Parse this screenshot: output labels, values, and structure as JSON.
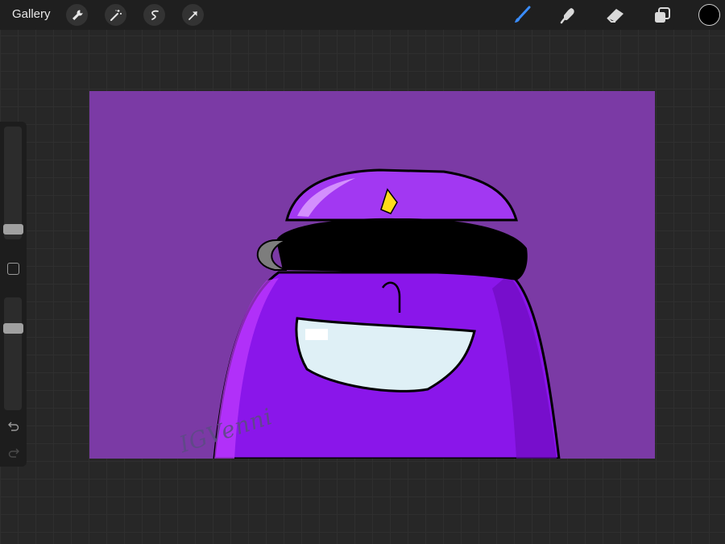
{
  "topbar": {
    "gallery_label": "Gallery",
    "left_tools": [
      "wrench-icon",
      "magic-wand-icon",
      "selection-icon",
      "transform-arrow-icon"
    ],
    "right_tools": [
      "brush-icon",
      "smudge-icon",
      "eraser-icon",
      "layers-icon"
    ],
    "active_tool": "brush",
    "active_tool_color": "#3a8dff",
    "current_color": "#000000"
  },
  "sidebar": {
    "brush_size": 0.05,
    "opacity": 0.75
  },
  "canvas": {
    "background_color": "#7b3aa5",
    "signature": "IGVenni"
  }
}
